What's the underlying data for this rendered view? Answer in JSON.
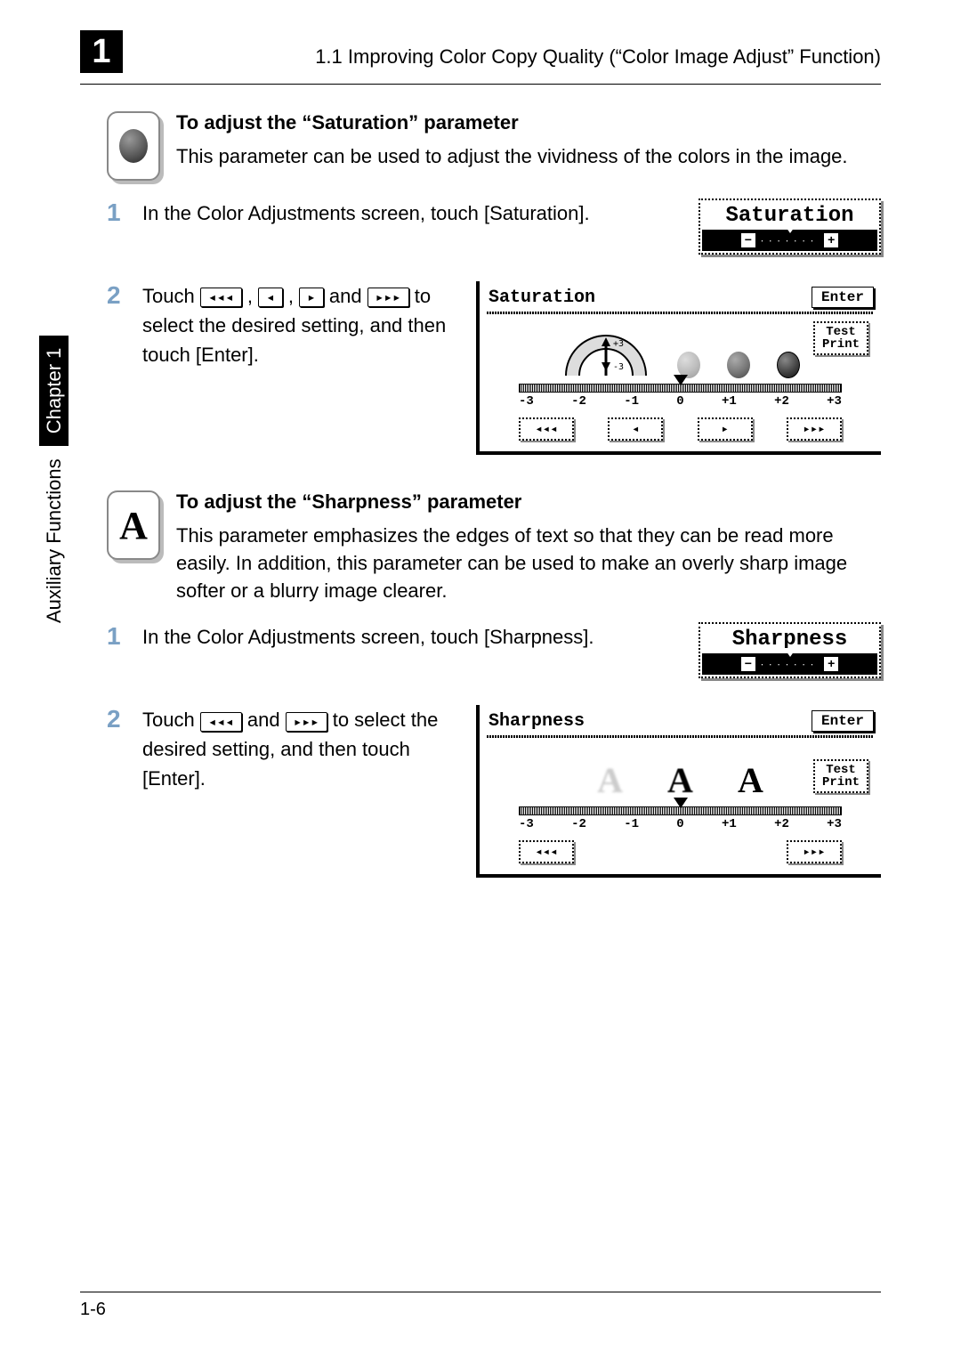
{
  "header": {
    "chapter_tab": "1",
    "title": "1.1 Improving Color Copy Quality (“Color Image Adjust” Function)"
  },
  "sidebar": {
    "text": "Auxiliary Functions",
    "chapter": "Chapter 1"
  },
  "saturation_section": {
    "title": "To adjust the “Saturation” parameter",
    "desc": "This parameter can be used to adjust the vividness of the colors in the image."
  },
  "saturation_steps": {
    "s1": {
      "num": "1",
      "text": "In the Color Adjustments screen, touch [Saturation]."
    },
    "s2": {
      "num": "2",
      "pre": "Touch ",
      "mid1": ", ",
      "mid2": ", ",
      "mid3": " and ",
      "post": " to select the desired setting, and then touch [Enter]."
    }
  },
  "inline_buttons": {
    "rrr": "◂◂◂",
    "r": "◂",
    "f": "▸",
    "fff": "▸▸▸"
  },
  "chip_saturation": {
    "title": "Saturation"
  },
  "panel_saturation": {
    "title": "Saturation",
    "enter": "Enter",
    "test_print_l1": "Test",
    "test_print_l2": "Print",
    "scale": {
      "n3": "-3",
      "n2": "-2",
      "n1": "-1",
      "z": "0",
      "p1": "+1",
      "p2": "+2",
      "p3": "+3"
    },
    "arrows": {
      "rrr": "◂◂◂",
      "r": "◂",
      "f": "▸",
      "fff": "▸▸▸"
    },
    "gauge": {
      "up": "+3",
      "down": "-3"
    }
  },
  "sharpness_section": {
    "title": "To adjust the “Sharpness” parameter",
    "desc": "This parameter emphasizes the edges of text so that they can be read more easily. In addition, this parameter can be used to make an overly sharp image softer or a blurry image clearer."
  },
  "sharpness_steps": {
    "s1": {
      "num": "1",
      "text": "In the Color Adjustments screen, touch [Sharpness]."
    },
    "s2": {
      "num": "2",
      "pre": "Touch ",
      "mid": " and ",
      "post": " to select the desired setting, and then touch [Enter]."
    }
  },
  "chip_sharpness": {
    "title": "Sharpness"
  },
  "panel_sharpness": {
    "title": "Sharpness",
    "enter": "Enter",
    "test_print_l1": "Test",
    "test_print_l2": "Print",
    "scale": {
      "n3": "-3",
      "n2": "-2",
      "n1": "-1",
      "z": "0",
      "p1": "+1",
      "p2": "+2",
      "p3": "+3"
    },
    "arrows": {
      "rrr": "◂◂◂",
      "fff": "▸▸▸"
    },
    "samples": {
      "a1": "A",
      "a2": "A",
      "a3": "A"
    }
  },
  "footer": {
    "page": "1-6"
  }
}
